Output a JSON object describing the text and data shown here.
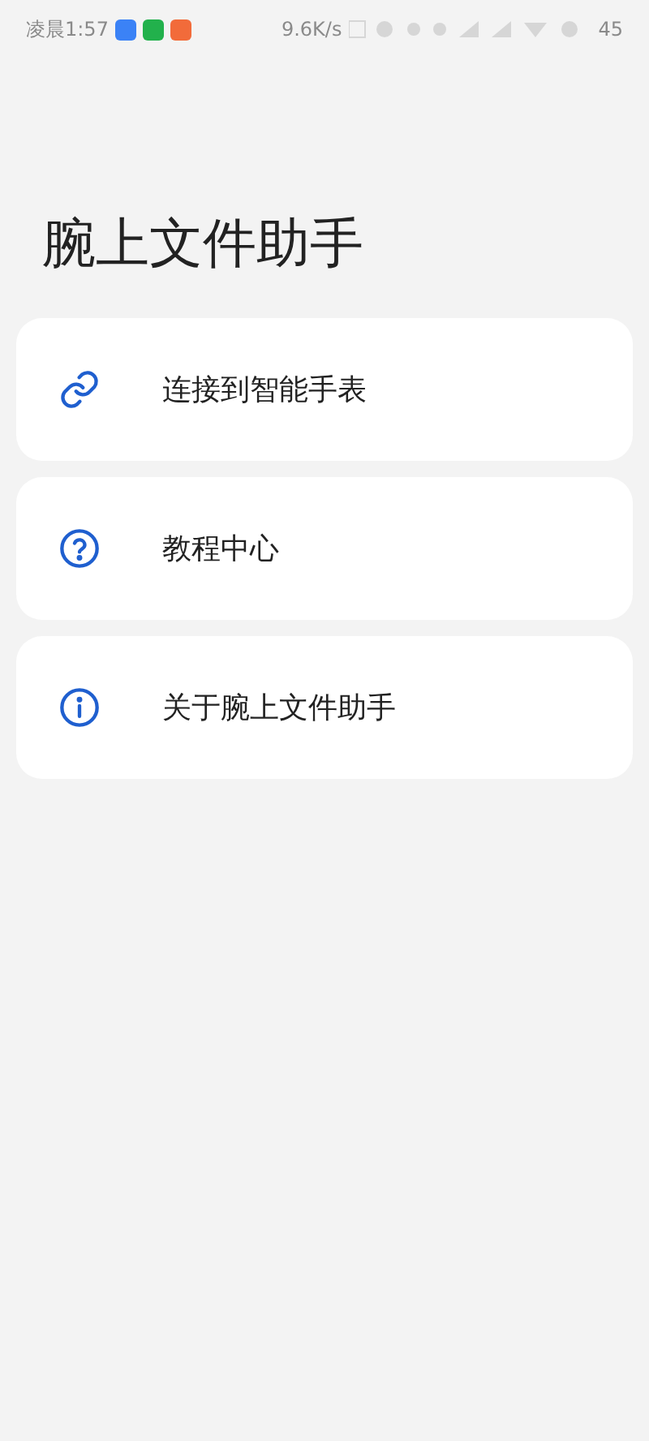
{
  "status_bar": {
    "time": "凌晨1:57",
    "speed": "9.6K/s",
    "battery": "45"
  },
  "title": "腕上文件助手",
  "menu": [
    {
      "kind": "link",
      "label": "连接到智能手表"
    },
    {
      "kind": "help",
      "label": "教程中心"
    },
    {
      "kind": "info",
      "label": "关于腕上文件助手"
    }
  ]
}
